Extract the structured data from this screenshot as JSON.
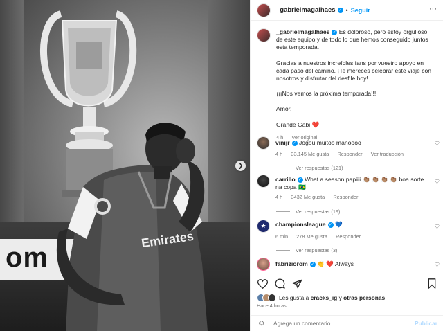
{
  "post": {
    "author": "_gabrielmagalhaes",
    "follow_label": "Seguir",
    "separator": "•",
    "more_label": "···",
    "photo_banner_text": "om",
    "photo_shirt_text": "Emirates"
  },
  "caption": {
    "username": "_gabrielmagalhaes",
    "p1": "Es doloroso, pero estoy orgulloso de este equipo y de todo lo que hemos conseguido juntos esta temporada.",
    "p2": "Gracias a nuestros increíbles fans por vuestro apoyo en cada paso del camino. ¡Te mereces celebrar este viaje con nosotros y disfrutar del desfile hoy!",
    "p3": "¡¡¡Nos vemos la próxima temporada!!!",
    "p4": "Amor,",
    "p5": "Grande Gabi ❤️",
    "time": "4 h",
    "translate": "Ver original"
  },
  "comments": [
    {
      "username": "vinijr",
      "text": "Jogou muitoo manoooo",
      "time": "4 h",
      "likes": "33.145 Me gusta",
      "reply": "Responder",
      "translate": "Ver traducción",
      "replies": "Ver respuestas (121)"
    },
    {
      "username": "carrillo",
      "text": "What a season papiiii 👏🏽 👏🏽 👏🏽 👏🏽 boa sorte na copa 🇧🇷",
      "time": "4 h",
      "likes": "3432 Me gusta",
      "reply": "Responder",
      "replies": "Ver respuestas (19)"
    },
    {
      "username": "championsleague",
      "text": "💙",
      "time": "6 min",
      "likes": "278 Me gusta",
      "reply": "Responder",
      "replies": "Ver respuestas (3)"
    },
    {
      "username": "fabriziorom",
      "text": "👏 ❤️ Always"
    }
  ],
  "likes": {
    "prefix": "Les gusta a",
    "user": "cracks_ig",
    "mid": "y",
    "others": "otras personas",
    "time_ago": "Hace 4 horas"
  },
  "comment_box": {
    "placeholder": "Agrega un comentario...",
    "post_label": "Publicar",
    "emoji": "☺"
  },
  "colors": {
    "accent": "#0095f6",
    "muted": "#737373",
    "border": "#efefef"
  },
  "icons": [
    "heart-icon",
    "comment-icon",
    "share-icon",
    "bookmark-icon",
    "emoji-icon",
    "verified-icon",
    "chevron-right-icon",
    "more-icon"
  ]
}
